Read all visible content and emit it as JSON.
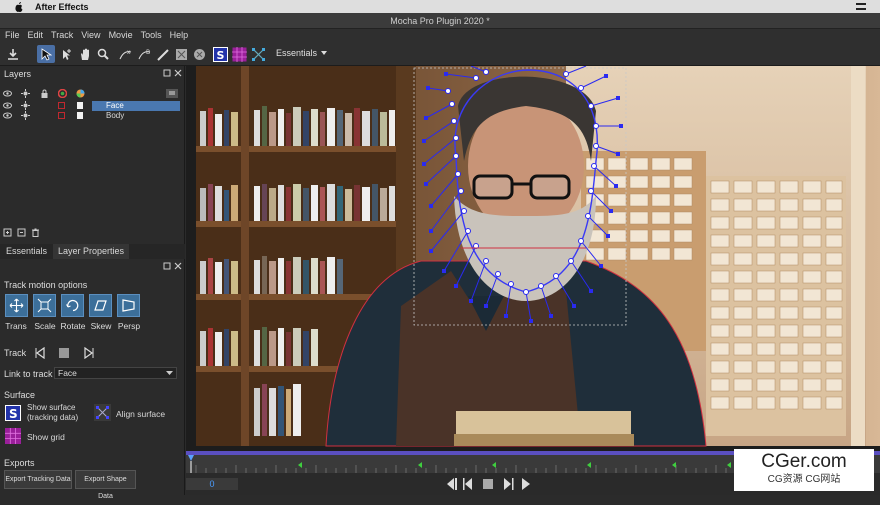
{
  "system": {
    "app_name": "After Effects"
  },
  "window": {
    "title": "Mocha Pro Plugin 2020 *"
  },
  "menu": [
    "File",
    "Edit",
    "Track",
    "View",
    "Movie",
    "Tools",
    "Help"
  ],
  "toolbar": {
    "workspace": "Essentials"
  },
  "layers_panel": {
    "title": "Layers",
    "layers": [
      {
        "name": "Face",
        "selected": true
      },
      {
        "name": "Body",
        "selected": false
      }
    ]
  },
  "tabs": {
    "essentials": "Essentials",
    "layer_properties": "Layer Properties"
  },
  "track_motion": {
    "heading": "Track motion options",
    "options": [
      "Trans",
      "Scale",
      "Rotate",
      "Skew",
      "Persp"
    ]
  },
  "track": {
    "label": "Track"
  },
  "link": {
    "label": "Link to track",
    "value": "Face"
  },
  "surface": {
    "heading": "Surface",
    "show_surface": "Show surface\n(tracking data)",
    "align_surface": "Align surface",
    "show_grid": "Show grid"
  },
  "exports": {
    "heading": "Exports",
    "tracking_button": "Export Tracking Data",
    "shape_button": "Export Shape Data"
  },
  "timeline": {
    "frame": "0"
  },
  "watermark": {
    "main": "CGer.com",
    "sub": "CG资源  CG网站"
  },
  "colors": {
    "accent": "#4a78b0",
    "spline": "#2a2af0",
    "layer_red": "#c0282e"
  }
}
